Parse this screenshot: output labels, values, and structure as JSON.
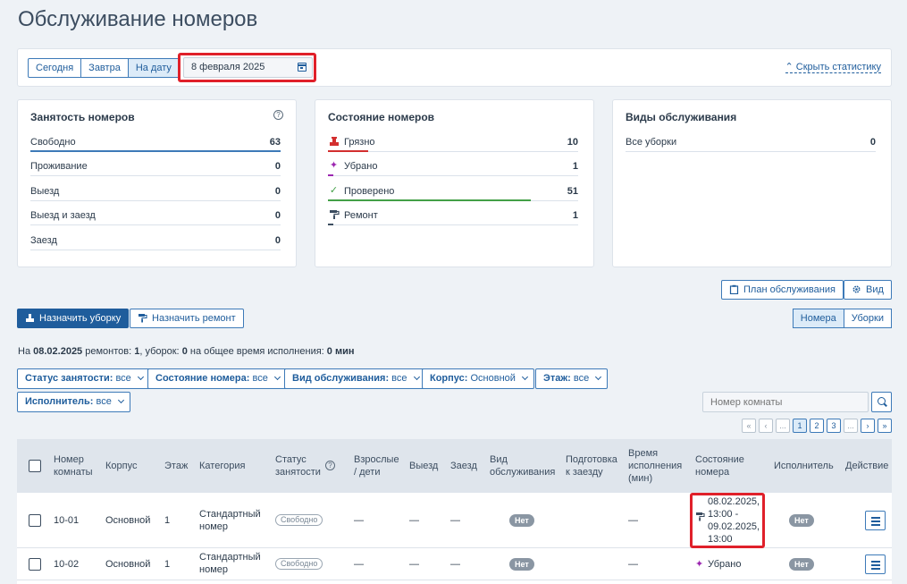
{
  "page": {
    "title": "Обслуживание номеров"
  },
  "toolbar": {
    "date_tabs": [
      "Сегодня",
      "Завтра",
      "На дату"
    ],
    "active_tab": "На дату",
    "date_value": "8 февраля 2025",
    "hide_stats": "Скрыть статистику"
  },
  "occupancy": {
    "title": "Занятость номеров",
    "rows": [
      {
        "label": "Свободно",
        "value": "63",
        "level": 1.0
      },
      {
        "label": "Проживание",
        "value": "0",
        "level": 0
      },
      {
        "label": "Выезд",
        "value": "0",
        "level": 0
      },
      {
        "label": "Выезд и заезд",
        "value": "0",
        "level": 0
      },
      {
        "label": "Заезд",
        "value": "0",
        "level": 0
      }
    ],
    "bar_color": "#3d7ab8"
  },
  "room_state": {
    "title": "Состояние номеров",
    "rows": [
      {
        "label": "Грязно",
        "value": "10",
        "icon": "dirty-icon",
        "color": "#d32f2f",
        "level": 0.16
      },
      {
        "label": "Убрано",
        "value": "1",
        "icon": "sparkle-icon",
        "color": "#9c27b0",
        "level": 0.02
      },
      {
        "label": "Проверено",
        "value": "51",
        "icon": "check-icon",
        "color": "#43a047",
        "level": 0.81
      },
      {
        "label": "Ремонт",
        "value": "1",
        "icon": "paint-roller-icon",
        "color": "#3c4d60",
        "level": 0.02
      }
    ]
  },
  "service_types": {
    "title": "Виды обслуживания",
    "rows": [
      {
        "label": "Все уборки",
        "value": "0"
      }
    ]
  },
  "actions": {
    "plan": "План обслуживания",
    "view": "Вид",
    "assign_cleaning": "Назначить уборку",
    "assign_repair": "Назначить ремонт",
    "mode_tabs": [
      "Номера",
      "Уборки"
    ],
    "active_mode": "Номера"
  },
  "summary": {
    "p1": "На ",
    "date": "08.02.2025",
    "p2": " ремонтов: ",
    "repairs": "1",
    "p3": ", уборок: ",
    "cleanings": "0",
    "p4": " на общее время исполнения: ",
    "time": "0 мин"
  },
  "filters": [
    {
      "label": "Статус занятости:",
      "value": "все"
    },
    {
      "label": "Состояние номера:",
      "value": "все"
    },
    {
      "label": "Вид обслуживания:",
      "value": "все"
    },
    {
      "label": "Корпус:",
      "value": "Основной"
    },
    {
      "label": "Этаж:",
      "value": "все"
    },
    {
      "label": "Исполнитель:",
      "value": "все"
    }
  ],
  "search": {
    "placeholder": "Номер комнаты"
  },
  "pager": [
    "«",
    "‹",
    "...",
    "1",
    "2",
    "3",
    "...",
    "›",
    "»"
  ],
  "table": {
    "headers": {
      "room": "Номер комнаты",
      "building": "Корпус",
      "floor": "Этаж",
      "category": "Категория",
      "status": "Статус занятости",
      "guests": "Взрослые / дети",
      "checkout": "Выезд",
      "checkin": "Заезд",
      "service": "Вид обслуживания",
      "prep": "Подготовка к заезду",
      "time": "Время исполнения (мин)",
      "state": "Состояние номера",
      "executor": "Исполнитель",
      "action": "Действие"
    },
    "rows": [
      {
        "room": "10-01",
        "building": "Основной",
        "floor": "1",
        "category": "Стандартный номер",
        "status": "Свободно",
        "guests": "—",
        "checkout": "—",
        "checkin": "—",
        "service": "Нет",
        "time": "—",
        "state_icon": "paint-roller-icon",
        "state": "08.02.2025, 13:00 - 09.02.2025, 13:00",
        "executor": "Нет"
      },
      {
        "room": "10-02",
        "building": "Основной",
        "floor": "1",
        "category": "Стандартный номер",
        "status": "Свободно",
        "guests": "—",
        "checkout": "—",
        "checkin": "—",
        "service": "Нет",
        "time": "—",
        "state_icon": "sparkle-icon",
        "state": "Убрано",
        "executor": "Нет"
      }
    ]
  }
}
